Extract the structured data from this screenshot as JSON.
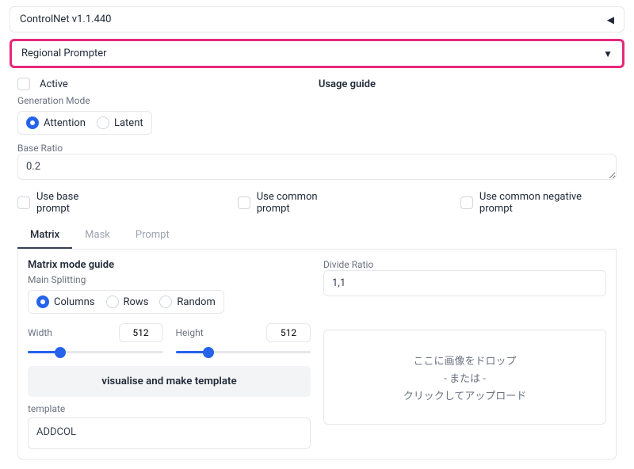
{
  "accordions": {
    "controlnet": {
      "title": "ControlNet v1.1.440"
    },
    "regional": {
      "title": "Regional Prompter"
    }
  },
  "panel": {
    "usage_guide": "Usage guide",
    "active": "Active",
    "generation_mode": "Generation Mode",
    "gen_modes": {
      "attention": "Attention",
      "latent": "Latent"
    },
    "base_ratio_label": "Base Ratio",
    "base_ratio_value": "0.2",
    "use_base": "Use base prompt",
    "use_common": "Use common prompt",
    "use_common_neg": "Use common negative prompt",
    "tabs": {
      "matrix": "Matrix",
      "mask": "Mask",
      "prompt": "Prompt"
    },
    "matrix": {
      "guide_title": "Matrix mode guide",
      "main_splitting": "Main Splitting",
      "split_opts": {
        "columns": "Columns",
        "rows": "Rows",
        "random": "Random"
      },
      "width_label": "Width",
      "width_value": "512",
      "height_label": "Height",
      "height_value": "512",
      "visualise_btn": "visualise and make template",
      "template_label": "template",
      "template_value": "ADDCOL",
      "divide_ratio_label": "Divide Ratio",
      "divide_ratio_value": "1,1",
      "drop_l1": "ここに画像をドロップ",
      "drop_l2": "- または -",
      "drop_l3": "クリックしてアップロード"
    }
  }
}
